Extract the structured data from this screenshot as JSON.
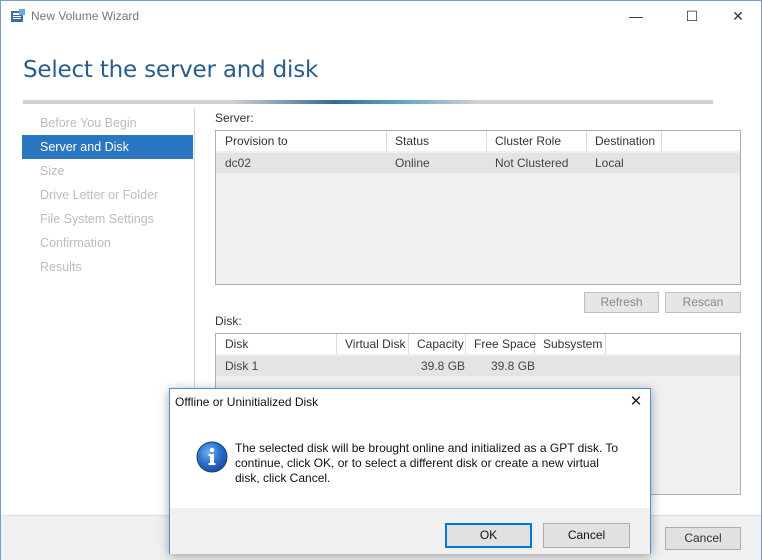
{
  "window": {
    "title": "New Volume Wizard",
    "minimize_glyph": "—",
    "maximize_glyph": "☐",
    "close_glyph": "✕"
  },
  "page": {
    "heading": "Select the server and disk"
  },
  "nav": {
    "items": [
      {
        "label": "Before You Begin",
        "active": false
      },
      {
        "label": "Server and Disk",
        "active": true
      },
      {
        "label": "Size",
        "active": false
      },
      {
        "label": "Drive Letter or Folder",
        "active": false
      },
      {
        "label": "File System Settings",
        "active": false
      },
      {
        "label": "Confirmation",
        "active": false
      },
      {
        "label": "Results",
        "active": false
      }
    ]
  },
  "server": {
    "label": "Server:",
    "columns": [
      "Provision to",
      "Status",
      "Cluster Role",
      "Destination"
    ],
    "rows": [
      [
        "dc02",
        "Online",
        "Not Clustered",
        "Local"
      ]
    ],
    "refresh_label": "Refresh",
    "rescan_label": "Rescan"
  },
  "disk": {
    "label": "Disk:",
    "columns": [
      "Disk",
      "Virtual Disk",
      "Capacity",
      "Free Space",
      "Subsystem"
    ],
    "rows": [
      [
        "Disk 1",
        "",
        "39.8 GB",
        "39.8 GB",
        ""
      ]
    ]
  },
  "footer": {
    "cancel_label": "Cancel"
  },
  "dialog": {
    "title": "Offline or Uninitialized Disk",
    "close_glyph": "✕",
    "message": "The selected disk will be brought online and initialized as a GPT disk. To continue, click OK, or to select a different disk or create a new virtual disk, click Cancel.",
    "icon": "info-icon",
    "ok_label": "OK",
    "cancel_label": "Cancel"
  },
  "colors": {
    "accent": "#2a76c1",
    "heading": "#2a5d8a",
    "dialog_border": "#4a90d9"
  }
}
